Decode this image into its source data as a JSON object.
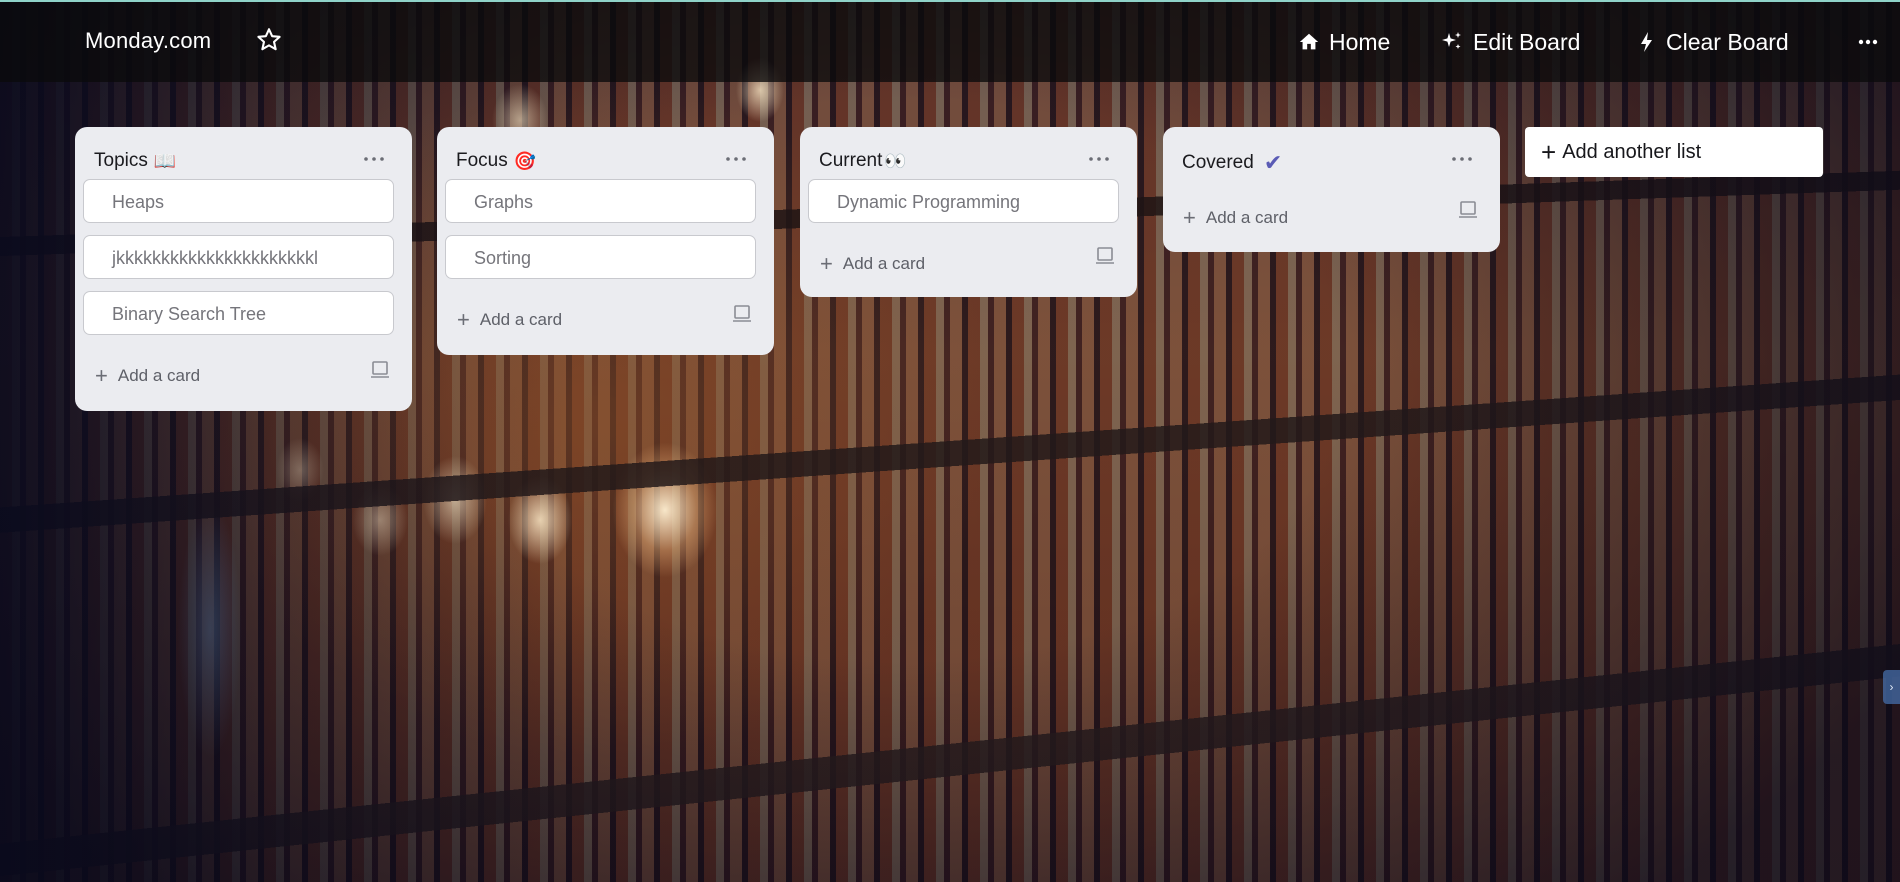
{
  "header": {
    "brand": "Monday.com",
    "star_icon": "star-outline-icon",
    "nav": [
      {
        "label": "Home",
        "icon": "home-icon"
      },
      {
        "label": "Edit Board",
        "icon": "sparkle-icon"
      },
      {
        "label": "Clear Board",
        "icon": "lightning-icon"
      }
    ],
    "more_icon": "more-horizontal-icon"
  },
  "lists": [
    {
      "title": "Topics",
      "emoji": "📖",
      "cards": [
        "Heaps",
        "jkkkkkkkkkkkkkkkkkkkkkkl",
        "Binary Search Tree"
      ],
      "add_card_label": "Add a card"
    },
    {
      "title": "Focus",
      "emoji": "🎯",
      "cards": [
        "Graphs",
        "Sorting"
      ],
      "add_card_label": "Add a card"
    },
    {
      "title": "Current",
      "emoji": "👀",
      "cards": [
        "Dynamic Programming"
      ],
      "add_card_label": "Add a card"
    },
    {
      "title": "Covered",
      "emoji": "✔",
      "cards": [],
      "add_card_label": "Add a card"
    }
  ],
  "add_list_label": "Add another list",
  "colors": {
    "topbar_bg": "#0a0a0c",
    "list_bg": "#ebecf0",
    "card_text": "#75757b",
    "check_color": "#5a5bb5",
    "accent_line": "#8fd3c9"
  }
}
